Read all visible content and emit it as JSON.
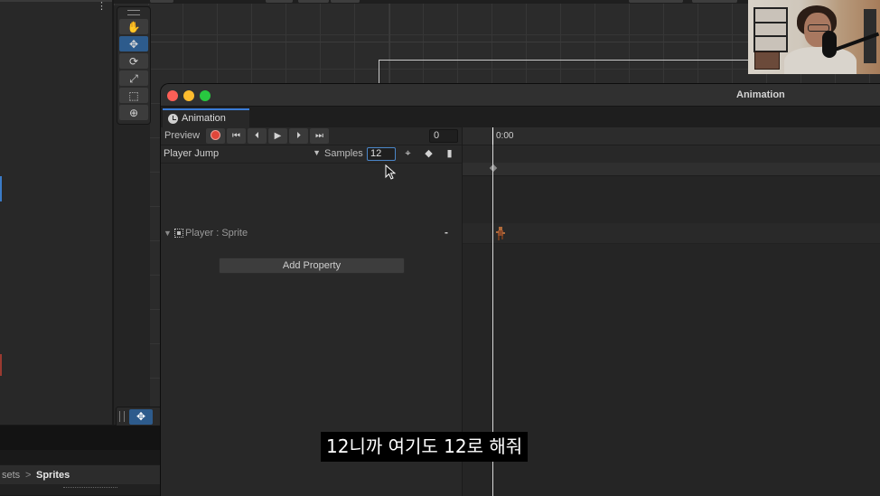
{
  "window": {
    "title": "Animation",
    "tab_label": "Animation"
  },
  "toolbar": {
    "preview_label": "Preview",
    "frame_value": "0",
    "playback_buttons": [
      {
        "name": "record-button",
        "icon": "record-icon"
      },
      {
        "name": "first-frame-button",
        "icon": "skip-to-start-icon",
        "glyph": "⏮"
      },
      {
        "name": "previous-frame-button",
        "icon": "step-back-icon",
        "glyph": "⏴"
      },
      {
        "name": "play-button",
        "icon": "play-icon",
        "glyph": "▶"
      },
      {
        "name": "next-frame-button",
        "icon": "step-forward-icon",
        "glyph": "⏵"
      },
      {
        "name": "last-frame-button",
        "icon": "skip-to-end-icon",
        "glyph": "⏭"
      }
    ],
    "clip_name": "Player Jump",
    "samples_label": "Samples",
    "samples_value": "12"
  },
  "properties": {
    "rows": [
      {
        "name": "Player : Sprite"
      }
    ],
    "remove_label": "-",
    "add_property_label": "Add Property"
  },
  "timeline": {
    "current_time_label": "0:00"
  },
  "project": {
    "breadcrumb_parent": "sets",
    "breadcrumb_separator": ">",
    "breadcrumb_current": "Sprites"
  },
  "subtitle": {
    "text": "12니까 여기도 12로 해줘"
  },
  "colors": {
    "accent": "#3a7bd5",
    "record": "#e0463a",
    "close": "#fe5f57",
    "minimize": "#febc2e",
    "zoom": "#28c840"
  }
}
